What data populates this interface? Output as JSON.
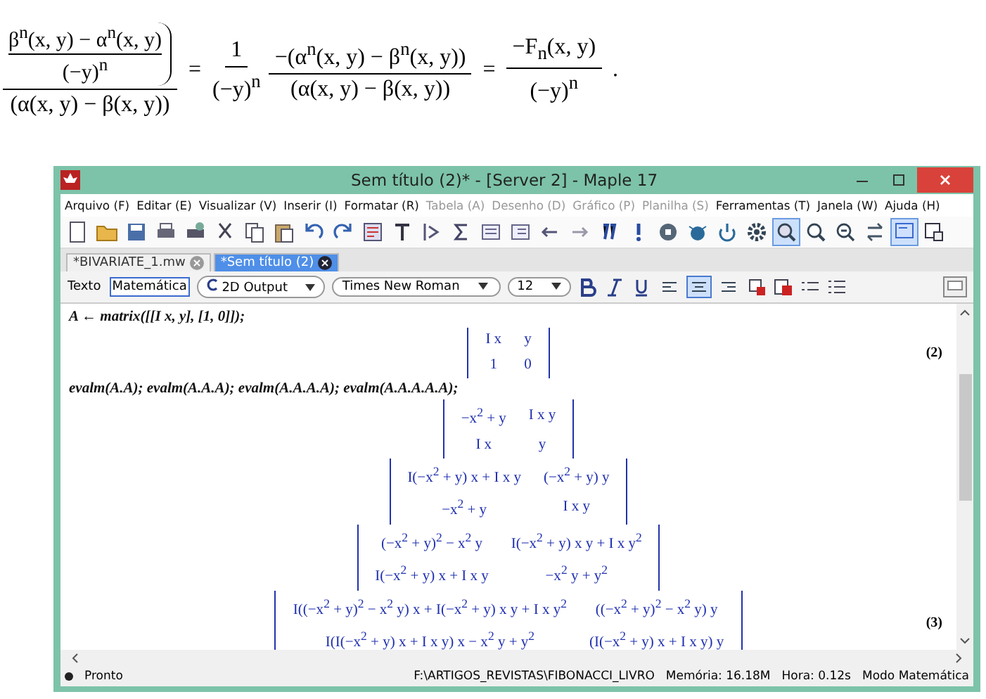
{
  "formula": {
    "terms": [
      {
        "kind": "nested_fraction",
        "top": "β$^{n}$(x, y) − α$^{n}$(x, y)",
        "middle": "(−y)$^{n}$",
        "bottom": "(α(x, y) − β(x, y))"
      },
      {
        "kind": "operator",
        "text": "="
      },
      {
        "kind": "fraction",
        "numerator": "1",
        "denominator": "(−y)$^{n}$"
      },
      {
        "kind": "fraction",
        "numerator": "−(α$^{n}$(x, y) − β$^{n}$(x, y))",
        "denominator": "(α(x, y) − β(x, y))"
      },
      {
        "kind": "operator",
        "text": "="
      },
      {
        "kind": "fraction",
        "numerator": "−F$_{n}$(x, y)",
        "denominator": "(−y)$^{n}$"
      },
      {
        "kind": "operator",
        "text": "."
      }
    ]
  },
  "window": {
    "title": "Sem título (2)* - [Server 2] - Maple 17"
  },
  "menu": [
    {
      "label": "Arquivo (F)",
      "disabled": false
    },
    {
      "label": "Editar (E)",
      "disabled": false
    },
    {
      "label": "Visualizar (V)",
      "disabled": false
    },
    {
      "label": "Inserir (I)",
      "disabled": false
    },
    {
      "label": "Formatar (R)",
      "disabled": false
    },
    {
      "label": "Tabela (A)",
      "disabled": true
    },
    {
      "label": "Desenho (D)",
      "disabled": true
    },
    {
      "label": "Gráfico (P)",
      "disabled": true
    },
    {
      "label": "Planilha (S)",
      "disabled": true
    },
    {
      "label": "Ferramentas (T)",
      "disabled": false
    },
    {
      "label": "Janela (W)",
      "disabled": false
    },
    {
      "label": "Ajuda (H)",
      "disabled": false
    }
  ],
  "tabs": [
    {
      "label": "*BIVARIATE_1.mw",
      "selected": false
    },
    {
      "label": "*Sem título (2)",
      "selected": true
    }
  ],
  "format_bar": {
    "modes": [
      {
        "label": "Texto",
        "selected": false
      },
      {
        "label": "Matemática",
        "selected": true
      }
    ],
    "style": "2D Output",
    "font": "Times New Roman",
    "size": "12",
    "alignments": [
      {
        "selected": false
      },
      {
        "selected": true
      },
      {
        "selected": false
      }
    ]
  },
  "document": [
    {
      "kind": "input",
      "text": "A ← matrix([[I x, y], [1, 0]]);"
    },
    {
      "kind": "matrix",
      "rows": [
        [
          "I x",
          "y"
        ],
        [
          "1",
          "0"
        ]
      ],
      "label": "(2)"
    },
    {
      "kind": "input",
      "text": "evalm(A.A); evalm(A.A.A); evalm(A.A.A.A); evalm(A.A.A.A.A);"
    },
    {
      "kind": "matrix",
      "rows": [
        [
          "−x$^{2}$ + y",
          "I x y"
        ],
        [
          "I x",
          "y"
        ]
      ]
    },
    {
      "kind": "matrix",
      "rows": [
        [
          "I(−x$^{2}$ + y) x + I x y",
          "(−x$^{2}$ + y) y"
        ],
        [
          "−x$^{2}$ + y",
          "I x y"
        ]
      ]
    },
    {
      "kind": "matrix",
      "rows": [
        [
          "(−x$^{2}$ + y)$^{2}$ − x$^{2}$ y",
          "I(−x$^{2}$ + y) x y + I x y$^{2}$"
        ],
        [
          "I(−x$^{2}$ + y) x + I x y",
          "−x$^{2}$ y + y$^{2}$"
        ]
      ]
    },
    {
      "kind": "matrix",
      "rows": [
        [
          "I((−x$^{2}$ + y)$^{2}$ − x$^{2}$ y) x + I(−x$^{2}$ + y) x y + I x y$^{2}$",
          "((−x$^{2}$ + y)$^{2}$ − x$^{2}$ y) y"
        ],
        [
          "I(I(−x$^{2}$ + y) x + I x y) x − x$^{2}$ y + y$^{2}$",
          "(I(−x$^{2}$ + y) x + I x y) y"
        ]
      ],
      "label": "(3)"
    }
  ],
  "status_bar": {
    "state": "Pronto",
    "path": "F:\\ARTIGOS_REVISTAS\\FIBONACCI_LIVRO",
    "memory": "Memória: 16.18M",
    "time": "Hora: 0.12s",
    "mode": "Modo Matemática"
  }
}
